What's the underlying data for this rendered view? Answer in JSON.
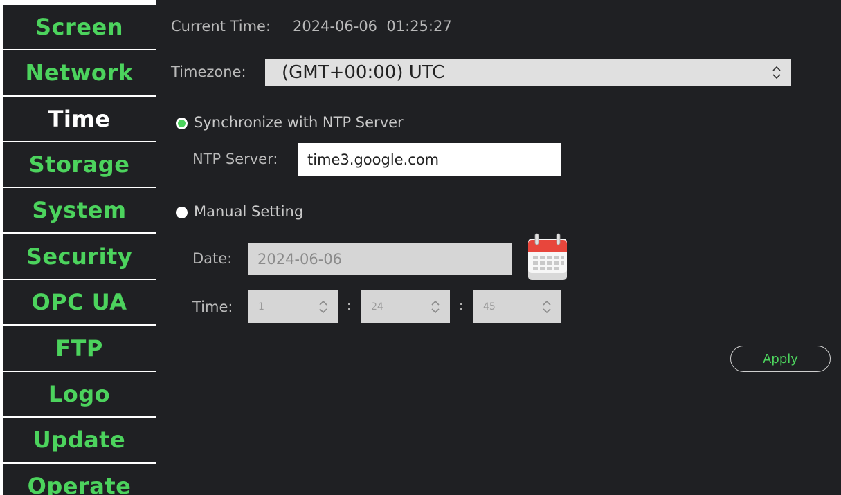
{
  "sidebar": {
    "items": [
      {
        "label": "Screen"
      },
      {
        "label": "Network"
      },
      {
        "label": "Time"
      },
      {
        "label": "Storage"
      },
      {
        "label": "System"
      },
      {
        "label": "Security"
      },
      {
        "label": "OPC UA"
      },
      {
        "label": "FTP"
      },
      {
        "label": "Logo"
      },
      {
        "label": "Update"
      },
      {
        "label": "Operate"
      }
    ],
    "active": "Time"
  },
  "time_settings": {
    "current_time_label": "Current Time:",
    "current_time_value": "2024-06-06  01:25:27",
    "timezone_label": "Timezone:",
    "timezone_value": "(GMT+00:00) UTC",
    "ntp_option_label": "Synchronize with NTP Server",
    "ntp_selected": true,
    "ntp_server_label": "NTP Server:",
    "ntp_server_value": "time3.google.com",
    "manual_option_label": "Manual Setting",
    "manual_selected": false,
    "date_label": "Date:",
    "date_value": "2024-06-06",
    "time_label": "Time:",
    "hour_value": "1",
    "minute_value": "24",
    "second_value": "45",
    "separator": ":",
    "apply_label": "Apply"
  },
  "icons": {
    "select_arrows": "chevron-up-down-icon",
    "calendar": "calendar-icon"
  },
  "colors": {
    "accent": "#4cd35d",
    "panel_bg": "#1f2023",
    "active_text": "#ffffff"
  }
}
